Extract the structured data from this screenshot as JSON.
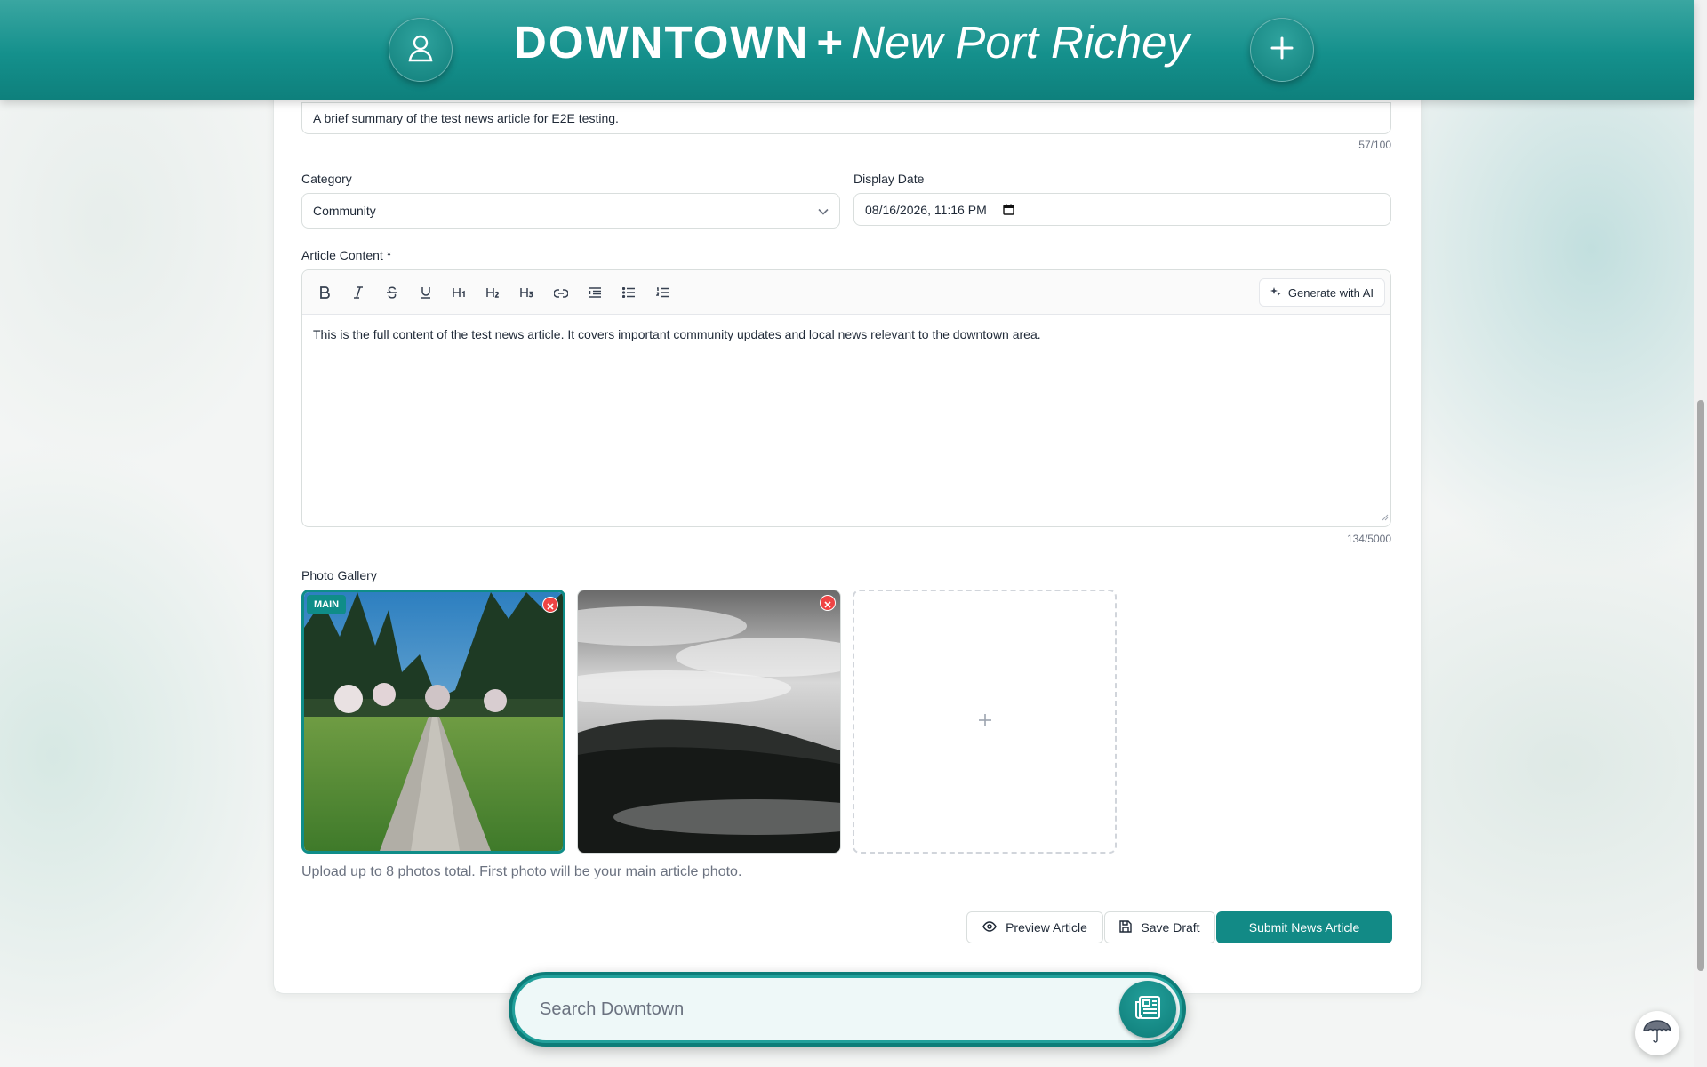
{
  "header": {
    "brand_main": "DOWNTOWN",
    "brand_plus": "+",
    "brand_city": "New Port Richey",
    "user_icon": "user-icon",
    "add_icon": "plus-icon"
  },
  "form": {
    "summary": {
      "value": "A brief summary of the test news article for E2E testing.",
      "counter": "57/100"
    },
    "category": {
      "label": "Category",
      "value": "Community"
    },
    "display_date": {
      "label": "Display Date",
      "value": "08/16/2026, 11:16 PM"
    },
    "content": {
      "label": "Article Content *",
      "toolbar": [
        "B",
        "I",
        "S",
        "U",
        "H1",
        "H2",
        "H3",
        "link",
        "blockquote",
        "bullet-list",
        "ordered-list"
      ],
      "ai_button": "Generate with AI",
      "body": "This is the full content of the test news article. It covers important community updates and local news relevant to the downtown area.",
      "counter": "134/5000"
    },
    "gallery": {
      "label": "Photo Gallery",
      "main_badge": "MAIN",
      "helper": "Upload up to 8 photos total. First photo will be your main article photo."
    },
    "actions": {
      "preview": "Preview Article",
      "draft": "Save Draft",
      "submit": "Submit News Article"
    }
  },
  "search": {
    "placeholder": "Search Downtown"
  },
  "colors": {
    "brand": "#128a86",
    "remove": "#ef4444"
  }
}
